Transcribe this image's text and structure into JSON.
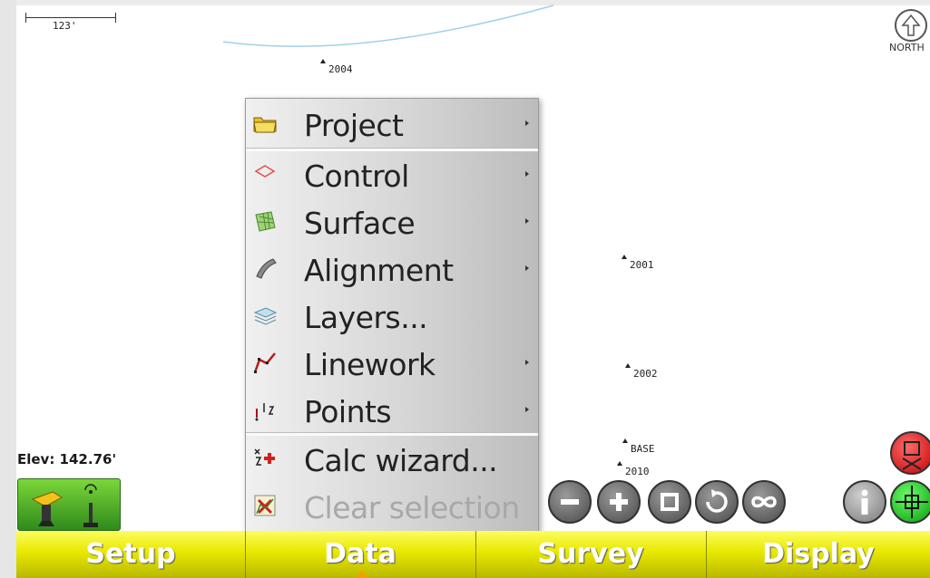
{
  "map": {
    "scale_label": "123'",
    "north_label": "NORTH",
    "elevation": "Elev: 142.76'",
    "points": [
      {
        "name": "2004"
      },
      {
        "name": "2001"
      },
      {
        "name": "2002"
      },
      {
        "name": "BASE"
      },
      {
        "name": "2010"
      }
    ]
  },
  "menu": {
    "items": [
      {
        "label": "Project",
        "submenu": true,
        "icon": "folder-icon"
      },
      {
        "label": "Control",
        "submenu": true,
        "icon": "control-diamond-icon"
      },
      {
        "label": "Surface",
        "submenu": true,
        "icon": "surface-grid-icon"
      },
      {
        "label": "Alignment",
        "submenu": true,
        "icon": "alignment-icon"
      },
      {
        "label": "Layers...",
        "submenu": false,
        "icon": "layers-icon"
      },
      {
        "label": "Linework",
        "submenu": true,
        "icon": "linework-icon"
      },
      {
        "label": "Points",
        "submenu": true,
        "icon": "points-icon"
      },
      {
        "label": "Calc wizard...",
        "submenu": false,
        "icon": "calc-wizard-icon"
      },
      {
        "label": "Clear selection",
        "submenu": false,
        "disabled": true,
        "icon": "clear-selection-icon"
      }
    ]
  },
  "toolbar": {
    "buttons": [
      "zoom-out-icon",
      "zoom-in-icon",
      "zoom-extents-icon",
      "rotate-icon",
      "infinity-icon",
      "info-icon",
      "target-icon",
      "stop-icon"
    ]
  },
  "tabs": {
    "setup": "Setup",
    "data": "Data",
    "survey": "Survey",
    "display": "Display",
    "active": "Data"
  },
  "colors": {
    "tab_bar": "#e8e800",
    "tab_text": "#ffffff",
    "gps_status": "#3aa51c",
    "stop_button": "#c20000",
    "target_button": "#0a9a0a"
  }
}
